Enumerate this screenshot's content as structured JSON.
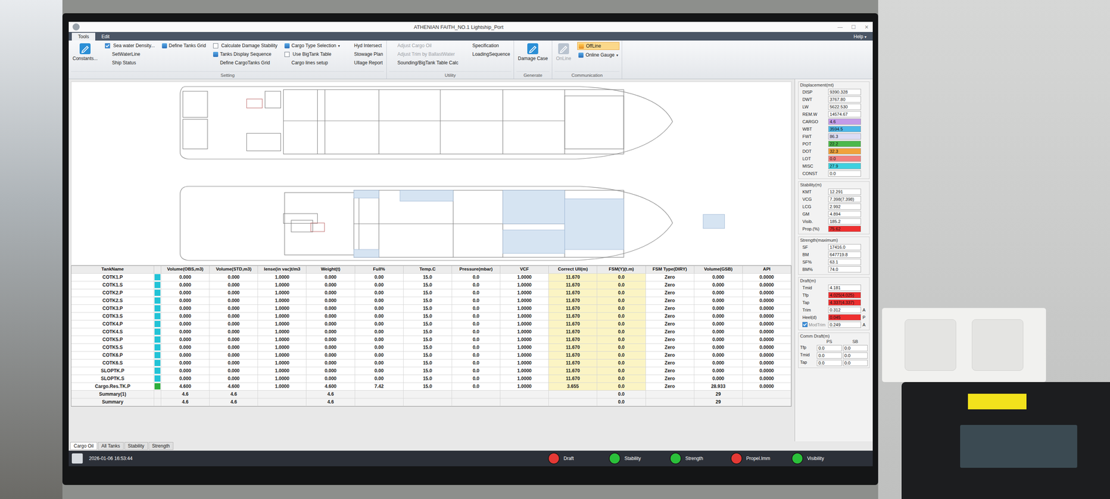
{
  "window": {
    "title": "ATHENIAN FAITH_NO.1 Lightship_Port",
    "controls": [
      "—",
      "☐",
      "✕"
    ]
  },
  "menu": {
    "tabs": [
      {
        "label": "Tools",
        "selected": true
      },
      {
        "label": "Edit",
        "selected": false
      }
    ],
    "help": "Help",
    "help_arrow": "▾"
  },
  "ribbon": [
    {
      "label": "Setting",
      "columns": [
        [
          {
            "text": "Constants...",
            "kind": "large",
            "disabled": false,
            "active": false
          }
        ],
        [
          {
            "text": "Sea water Density...",
            "kind": "checkbox",
            "checked": true,
            "disabled": false,
            "active": false
          },
          {
            "text": "SetWaterLine",
            "kind": "plain",
            "disabled": false,
            "active": false
          },
          {
            "text": "Ship Status",
            "kind": "plain",
            "disabled": false,
            "active": false
          }
        ],
        [
          {
            "text": "Define Tanks Grid",
            "kind": "icon",
            "disabled": false,
            "active": false
          }
        ],
        [
          {
            "text": "Calculate Damage Stability",
            "kind": "checkbox",
            "checked": false,
            "disabled": false,
            "active": false
          },
          {
            "text": "Tanks Display Sequence",
            "kind": "icon",
            "disabled": false,
            "active": false
          },
          {
            "text": "Define CargoTanks Grid",
            "kind": "plain",
            "disabled": false,
            "active": false
          }
        ],
        [
          {
            "text": "Cargo Type Selection",
            "kind": "dropdown",
            "arrow": "▾",
            "disabled": false,
            "active": false
          },
          {
            "text": "Use BigTank Table",
            "kind": "checkbox",
            "checked": false,
            "disabled": false,
            "active": false
          },
          {
            "text": "Cargo lines setup",
            "kind": "plain",
            "disabled": false,
            "active": false
          }
        ],
        [
          {
            "text": "Hyd Intersect",
            "kind": "plain",
            "disabled": false,
            "active": false
          },
          {
            "text": "Stowage Plan",
            "kind": "plain",
            "disabled": false,
            "active": false
          },
          {
            "text": "Ullage Report",
            "kind": "plain",
            "disabled": false,
            "active": false
          }
        ]
      ]
    },
    {
      "label": "Utility",
      "columns": [
        [
          {
            "text": "Adjust Cargo Oil",
            "kind": "plain",
            "disabled": true,
            "active": false
          },
          {
            "text": "Adjust Trim by BallastWater",
            "kind": "plain",
            "disabled": true,
            "active": false
          },
          {
            "text": "Sounding/BigTank Table Calc",
            "kind": "plain",
            "disabled": false,
            "active": false
          }
        ],
        [
          {
            "text": "Specification",
            "kind": "plain",
            "disabled": false,
            "active": false
          },
          {
            "text": "LoadingSequence",
            "kind": "plain",
            "disabled": false,
            "active": false
          }
        ]
      ]
    },
    {
      "label": "Generate",
      "columns": [
        [
          {
            "text": "Damage Case",
            "kind": "large",
            "disabled": false,
            "active": false
          }
        ]
      ]
    },
    {
      "label": "Communication",
      "columns": [
        [
          {
            "text": "OnLine",
            "kind": "large",
            "disabled": true,
            "active": false
          }
        ],
        [
          {
            "text": "OffLine",
            "kind": "icon",
            "disabled": false,
            "active": true
          },
          {
            "text": "Online Gauge",
            "kind": "dropdown",
            "arrow": "▾",
            "disabled": false,
            "active": false
          }
        ]
      ]
    }
  ],
  "table": {
    "columns": [
      {
        "label": "TankName",
        "highlight": false
      },
      {
        "label": "",
        "highlight": false
      },
      {
        "label": "Volume(OBS,m3)",
        "highlight": false
      },
      {
        "label": "Volume(STD,m3)",
        "highlight": false
      },
      {
        "label": "lense(in vac)t/m3",
        "highlight": false
      },
      {
        "label": "Weight(t)",
        "highlight": false
      },
      {
        "label": "Full%",
        "highlight": false
      },
      {
        "label": "Temp.C",
        "highlight": false
      },
      {
        "label": "Pressure(mbar)",
        "highlight": false
      },
      {
        "label": "VCF",
        "highlight": false
      },
      {
        "label": "Correct Ull(m)",
        "highlight": true
      },
      {
        "label": "FSM(Y)(t.m)",
        "highlight": true
      },
      {
        "label": "FSM Type(DIRY)",
        "highlight": false
      },
      {
        "label": "Volume(GSB)",
        "highlight": false
      },
      {
        "label": "API",
        "highlight": false
      }
    ],
    "rows": [
      {
        "name": "COTK1.P",
        "kind": "tank",
        "color": "#22c3d6",
        "cells": [
          "0.000",
          "0.000",
          "1.0000",
          "0.000",
          "0.00",
          "15.0",
          "0.0",
          "1.0000",
          "11.670",
          "0.0",
          "Zero",
          "0.000",
          "0.0000"
        ]
      },
      {
        "name": "COTK1.S",
        "kind": "tank",
        "color": "#22c3d6",
        "cells": [
          "0.000",
          "0.000",
          "1.0000",
          "0.000",
          "0.00",
          "15.0",
          "0.0",
          "1.0000",
          "11.670",
          "0.0",
          "Zero",
          "0.000",
          "0.0000"
        ]
      },
      {
        "name": "COTK2.P",
        "kind": "tank",
        "color": "#22c3d6",
        "cells": [
          "0.000",
          "0.000",
          "1.0000",
          "0.000",
          "0.00",
          "15.0",
          "0.0",
          "1.0000",
          "11.670",
          "0.0",
          "Zero",
          "0.000",
          "0.0000"
        ]
      },
      {
        "name": "COTK2.S",
        "kind": "tank",
        "color": "#22c3d6",
        "cells": [
          "0.000",
          "0.000",
          "1.0000",
          "0.000",
          "0.00",
          "15.0",
          "0.0",
          "1.0000",
          "11.670",
          "0.0",
          "Zero",
          "0.000",
          "0.0000"
        ]
      },
      {
        "name": "COTK3.P",
        "kind": "tank",
        "color": "#22c3d6",
        "cells": [
          "0.000",
          "0.000",
          "1.0000",
          "0.000",
          "0.00",
          "15.0",
          "0.0",
          "1.0000",
          "11.670",
          "0.0",
          "Zero",
          "0.000",
          "0.0000"
        ]
      },
      {
        "name": "COTK3.S",
        "kind": "tank",
        "color": "#22c3d6",
        "cells": [
          "0.000",
          "0.000",
          "1.0000",
          "0.000",
          "0.00",
          "15.0",
          "0.0",
          "1.0000",
          "11.670",
          "0.0",
          "Zero",
          "0.000",
          "0.0000"
        ]
      },
      {
        "name": "COTK4.P",
        "kind": "tank",
        "color": "#22c3d6",
        "cells": [
          "0.000",
          "0.000",
          "1.0000",
          "0.000",
          "0.00",
          "15.0",
          "0.0",
          "1.0000",
          "11.670",
          "0.0",
          "Zero",
          "0.000",
          "0.0000"
        ]
      },
      {
        "name": "COTK4.S",
        "kind": "tank",
        "color": "#22c3d6",
        "cells": [
          "0.000",
          "0.000",
          "1.0000",
          "0.000",
          "0.00",
          "15.0",
          "0.0",
          "1.0000",
          "11.670",
          "0.0",
          "Zero",
          "0.000",
          "0.0000"
        ]
      },
      {
        "name": "COTK5.P",
        "kind": "tank",
        "color": "#22c3d6",
        "cells": [
          "0.000",
          "0.000",
          "1.0000",
          "0.000",
          "0.00",
          "15.0",
          "0.0",
          "1.0000",
          "11.670",
          "0.0",
          "Zero",
          "0.000",
          "0.0000"
        ]
      },
      {
        "name": "COTK5.S",
        "kind": "tank",
        "color": "#22c3d6",
        "cells": [
          "0.000",
          "0.000",
          "1.0000",
          "0.000",
          "0.00",
          "15.0",
          "0.0",
          "1.0000",
          "11.670",
          "0.0",
          "Zero",
          "0.000",
          "0.0000"
        ]
      },
      {
        "name": "COTK6.P",
        "kind": "tank",
        "color": "#22c3d6",
        "cells": [
          "0.000",
          "0.000",
          "1.0000",
          "0.000",
          "0.00",
          "15.0",
          "0.0",
          "1.0000",
          "11.670",
          "0.0",
          "Zero",
          "0.000",
          "0.0000"
        ]
      },
      {
        "name": "COTK6.S",
        "kind": "tank",
        "color": "#22c3d6",
        "cells": [
          "0.000",
          "0.000",
          "1.0000",
          "0.000",
          "0.00",
          "15.0",
          "0.0",
          "1.0000",
          "11.670",
          "0.0",
          "Zero",
          "0.000",
          "0.0000"
        ]
      },
      {
        "name": "SLOPTK.P",
        "kind": "tank",
        "color": "#22c3d6",
        "cells": [
          "0.000",
          "0.000",
          "1.0000",
          "0.000",
          "0.00",
          "15.0",
          "0.0",
          "1.0000",
          "11.670",
          "0.0",
          "Zero",
          "0.000",
          "0.0000"
        ]
      },
      {
        "name": "SLOPTK.S",
        "kind": "tank",
        "color": "#22c3d6",
        "cells": [
          "0.000",
          "0.000",
          "1.0000",
          "0.000",
          "0.00",
          "15.0",
          "0.0",
          "1.0000",
          "11.670",
          "0.0",
          "Zero",
          "0.000",
          "0.0000"
        ]
      },
      {
        "name": "Cargo.Res.TK.P",
        "kind": "tank",
        "color": "#2fae3c",
        "cells": [
          "4.600",
          "4.600",
          "1.0000",
          "4.600",
          "7.42",
          "15.0",
          "0.0",
          "1.0000",
          "3.655",
          "0.0",
          "Zero",
          "28.933",
          "0.0000"
        ]
      },
      {
        "name": "Summary(1)",
        "kind": "summary",
        "color": null,
        "cells": [
          "4.6",
          "4.6",
          "",
          "4.6",
          "",
          "",
          "",
          "",
          "",
          "0.0",
          "",
          "29",
          ""
        ]
      },
      {
        "name": "Summary",
        "kind": "summary",
        "color": null,
        "cells": [
          "4.6",
          "4.6",
          "",
          "4.6",
          "",
          "",
          "",
          "",
          "",
          "0.0",
          "",
          "29",
          ""
        ]
      }
    ]
  },
  "side": {
    "sections": [
      {
        "title": "Displacement(mt)",
        "rows": [
          {
            "label": "DISP",
            "value": "9390.328",
            "suffix": "",
            "color": null
          },
          {
            "label": "DWT",
            "value": "3767.80",
            "suffix": "",
            "color": null
          },
          {
            "label": "LW",
            "value": "5622.530",
            "suffix": "",
            "color": null
          },
          {
            "label": "REM.W",
            "value": "14574.67",
            "suffix": "",
            "color": null
          },
          {
            "label": "CARGO",
            "value": "4.6",
            "suffix": "",
            "color": "#c39be8"
          },
          {
            "label": "WBT",
            "value": "3594.5",
            "suffix": "",
            "color": "#4fb8e8"
          },
          {
            "label": "FWT",
            "value": "86.3",
            "suffix": "",
            "color": "#dcdcf4"
          },
          {
            "label": "POT",
            "value": "22.2",
            "suffix": "",
            "color": "#4cb84c"
          },
          {
            "label": "DOT",
            "value": "32.3",
            "suffix": "",
            "color": "#f0a23c"
          },
          {
            "label": "LOT",
            "value": "0.0",
            "suffix": "",
            "color": "#f08080"
          },
          {
            "label": "MISC",
            "value": "27.9",
            "suffix": "",
            "color": "#3fd0df"
          },
          {
            "label": "CONST",
            "value": "0.0",
            "suffix": "",
            "color": null
          }
        ]
      },
      {
        "title": "Stability(m)",
        "rows": [
          {
            "label": "KMT",
            "value": "12.291",
            "suffix": "",
            "color": null
          },
          {
            "label": "VCG",
            "value": "7.398(7.398)",
            "suffix": "",
            "color": null
          },
          {
            "label": "LCG",
            "value": "2.992",
            "suffix": "",
            "color": null
          },
          {
            "label": "GM",
            "value": "4.894",
            "suffix": "",
            "color": null
          },
          {
            "label": "Visib.",
            "value": "185.2",
            "suffix": "",
            "color": null
          },
          {
            "label": "Prop.(%)",
            "value": "75.62",
            "suffix": "",
            "color": "#ee3030"
          }
        ]
      },
      {
        "title": "Strength(maximum)",
        "rows": [
          {
            "label": "SF",
            "value": "17416.0",
            "suffix": "",
            "color": null
          },
          {
            "label": "BM",
            "value": "647719.8",
            "suffix": "",
            "color": null
          },
          {
            "label": "SF%",
            "value": "63.1",
            "suffix": "",
            "color": null
          },
          {
            "label": "BM%",
            "value": "74.0",
            "suffix": "",
            "color": null
          }
        ]
      },
      {
        "title": "Draft(m)",
        "rows": [
          {
            "label": "Tmid",
            "value": "4.181",
            "suffix": "",
            "color": null
          },
          {
            "label": "Tfp",
            "value": "4.025(4.025)",
            "suffix": "",
            "color": "#ee3030"
          },
          {
            "label": "Tap",
            "value": "4.337(4.337)",
            "suffix": "",
            "color": "#ee3030"
          },
          {
            "label": "Trim",
            "value": "0.312",
            "suffix": "A",
            "color": null
          },
          {
            "label": "Heel(d)",
            "value": "0.045",
            "suffix": "P",
            "color": "#ee3030"
          },
          {
            "label": "ModTrim",
            "value": "0.249",
            "suffix": "A",
            "color": null,
            "kind": "checkbox",
            "checked": true,
            "disabled": true
          }
        ]
      }
    ],
    "comm": {
      "title": "Comm Draft(m)",
      "headers": [
        "",
        "PS",
        "SB"
      ],
      "rows": [
        [
          "Tfp",
          "0.0",
          "0.0"
        ],
        [
          "Tmid",
          "0.0",
          "0.0"
        ],
        [
          "Tap",
          "0.0",
          "0.0"
        ]
      ]
    }
  },
  "bottom_tabs": [
    {
      "label": "Cargo Oil",
      "selected": true
    },
    {
      "label": "All Tanks",
      "selected": false
    },
    {
      "label": "Stability",
      "selected": false
    },
    {
      "label": "Strength",
      "selected": false
    }
  ],
  "status_bar": {
    "time": "2026-01-06 16:53:44",
    "indicators": [
      {
        "label": "Draft",
        "color": "#e53935"
      },
      {
        "label": "Stability",
        "color": "#2bc03a"
      },
      {
        "label": "Strength",
        "color": "#2bc03a"
      },
      {
        "label": "Propel.Imm",
        "color": "#e53935"
      },
      {
        "label": "Visibility",
        "color": "#2bc03a"
      }
    ]
  }
}
